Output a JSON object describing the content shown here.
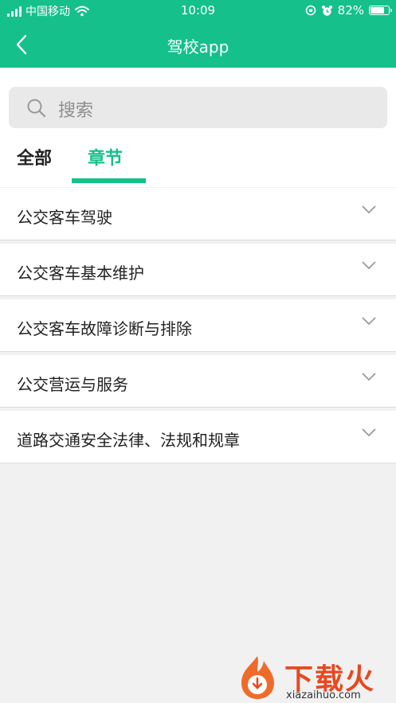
{
  "status_bar": {
    "carrier": "中国移动",
    "time": "10:09",
    "battery": "82%",
    "battery_level": 0.82
  },
  "header": {
    "title": "驾校app",
    "background": "#16c08a"
  },
  "search": {
    "placeholder": "搜索"
  },
  "tabs": [
    {
      "label": "全部",
      "active": false
    },
    {
      "label": "章节",
      "active": true
    }
  ],
  "chapters": [
    {
      "label": "公交客车驾驶"
    },
    {
      "label": "公交客车基本维护"
    },
    {
      "label": "公交客车故障诊断与排除"
    },
    {
      "label": "公交营运与服务"
    },
    {
      "label": "道路交通安全法律、法规和规章"
    }
  ],
  "watermark": {
    "text": "下载火",
    "url": "xiazaihuo.com"
  }
}
